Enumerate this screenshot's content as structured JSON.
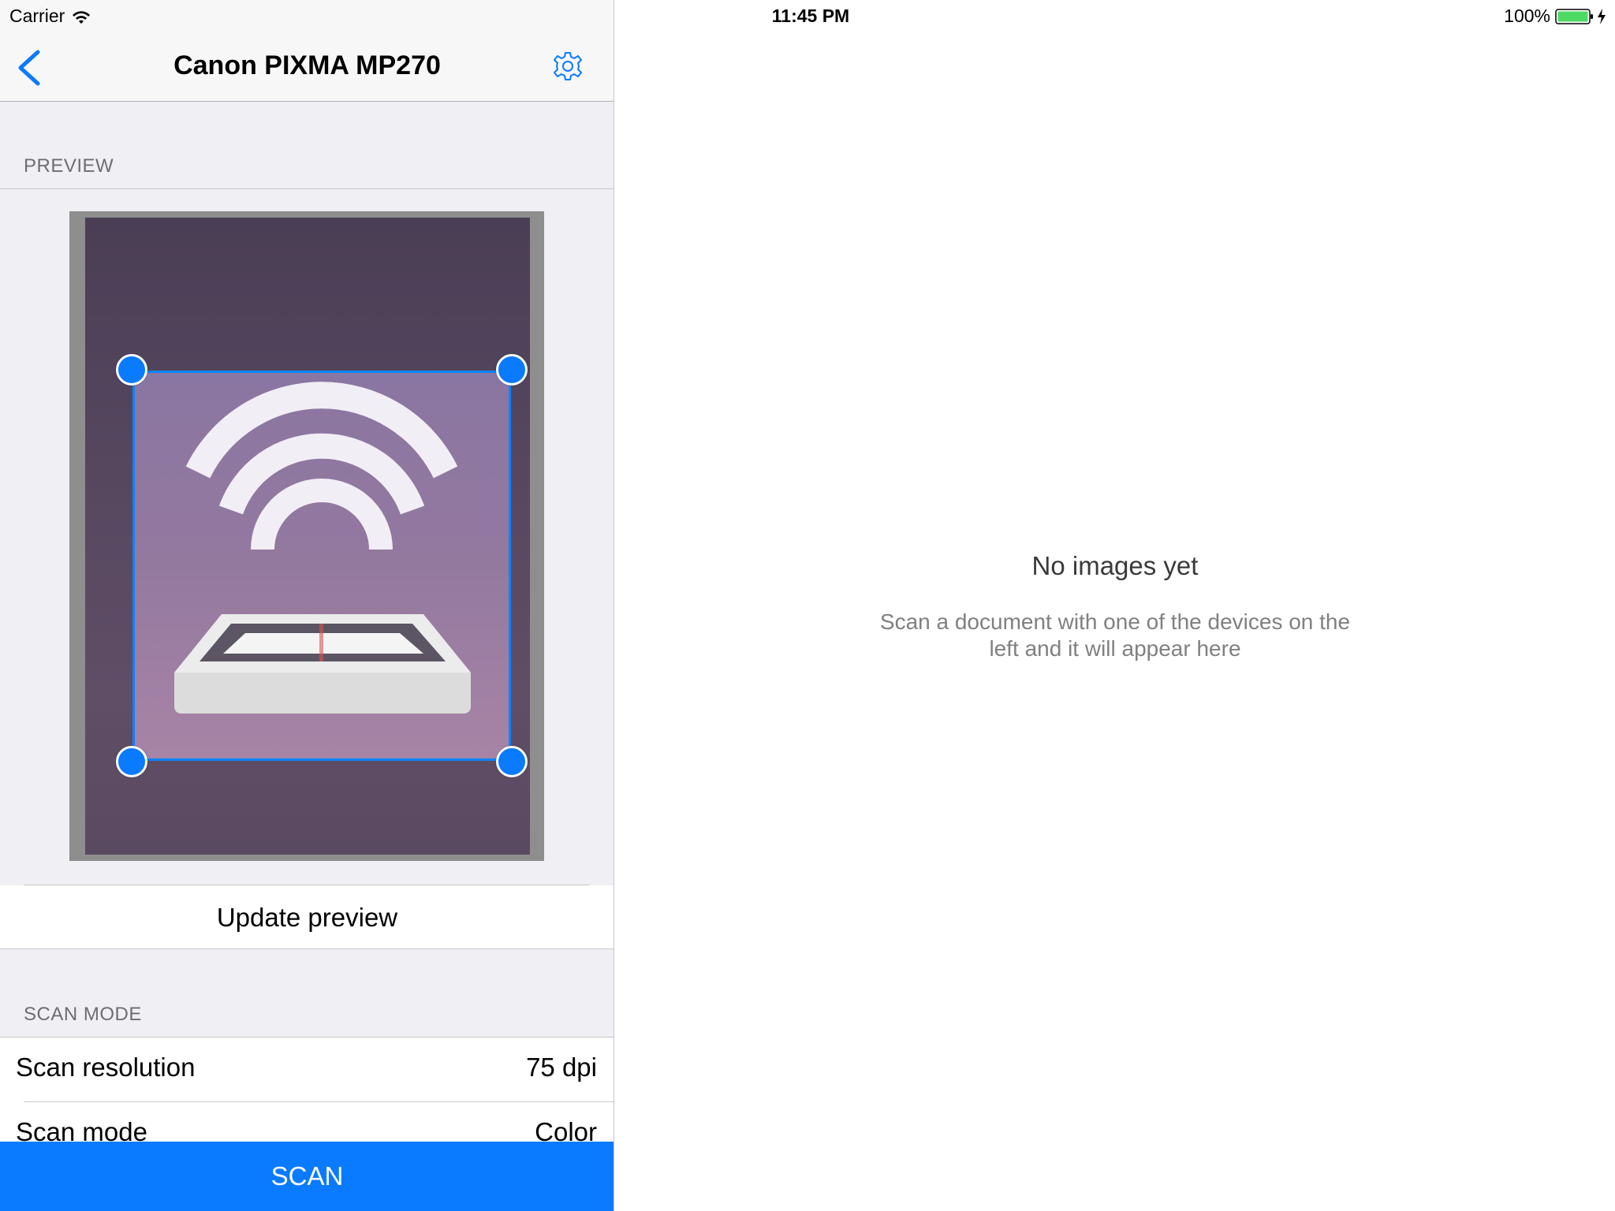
{
  "status_bar": {
    "carrier": "Carrier",
    "time": "11:45 PM",
    "battery": "100%"
  },
  "nav": {
    "title": "Canon PIXMA MP270",
    "back_icon": "chevron-left-icon",
    "settings_icon": "gear-icon"
  },
  "preview_section": {
    "header": "PREVIEW",
    "update_button": "Update preview"
  },
  "scan_mode_section": {
    "header": "SCAN MODE",
    "rows": [
      {
        "label": "Scan resolution",
        "value": "75 dpi"
      },
      {
        "label": "Scan mode",
        "value": "Color"
      }
    ]
  },
  "scan_button": "SCAN",
  "empty_state": {
    "title": "No images yet",
    "subtitle": "Scan a document with one of the devices on the left and it will appear here"
  },
  "colors": {
    "accent": "#0a7aff",
    "battery": "#4cd964"
  }
}
